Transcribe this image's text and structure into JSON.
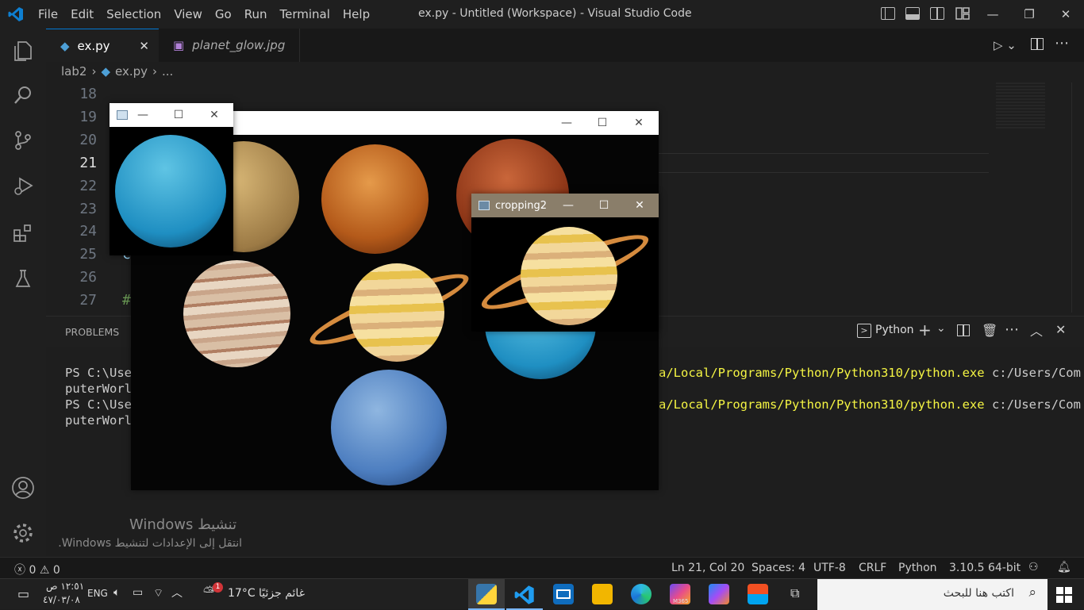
{
  "titlebar": {
    "menu": [
      "File",
      "Edit",
      "Selection",
      "View",
      "Go",
      "Run",
      "Terminal",
      "Help"
    ],
    "title": "ex.py - Untitled (Workspace) - Visual Studio Code"
  },
  "tabs": [
    {
      "label": "ex.py",
      "close": "✕"
    },
    {
      "label": "planet_glow.jpg"
    }
  ],
  "breadcrumb": {
    "folder": "lab2",
    "file": "ex.py",
    "more": "..."
  },
  "editor": {
    "line_numbers": [
      "18",
      "19",
      "20",
      "21",
      "22",
      "23",
      "24",
      "25",
      "26",
      "27"
    ],
    "current_line": "21",
    "visible_code": {
      "line25": "c",
      "line27": "#"
    }
  },
  "panel": {
    "tab": "PROBLEMS",
    "terminal_profile": "Python",
    "lines": [
      {
        "left": "PS C:\\User",
        "right_path": "a/Local/Programs/Python/Python310/python.exe",
        "right_arg": " c:/Users/Com"
      },
      {
        "left": "puterWorld"
      },
      {
        "left": "PS C:\\User",
        "right_path": "a/Local/Programs/Python/Python310/python.exe",
        "right_arg": " c:/Users/Com"
      },
      {
        "left": "puterWorld"
      }
    ]
  },
  "windows": {
    "small_title": "",
    "big_title": "",
    "crop_title": "cropping2"
  },
  "activation": {
    "title": "تنشيط Windows",
    "subtitle": "انتقل إلى الإعدادات لتنشيط Windows."
  },
  "status": {
    "errors": "0",
    "warnings": "0",
    "position": "Ln 21, Col 20",
    "spaces": "Spaces: 4",
    "encoding": "UTF-8",
    "eol": "CRLF",
    "language": "Python",
    "interpreter": "3.10.5 64-bit"
  },
  "taskbar": {
    "time": "١٢:٥١ ص",
    "date": "٤٧/٠٣/٠٨",
    "lang": "ENG",
    "temp": "17°C",
    "weather": "غائم جزئيًا",
    "search_placeholder": "اكتب هنا للبحث",
    "weather_badge": "1",
    "copilot_label": "M365"
  },
  "colors": {
    "accent": "#0078d4",
    "terminal_yellow": "#f5f543"
  }
}
